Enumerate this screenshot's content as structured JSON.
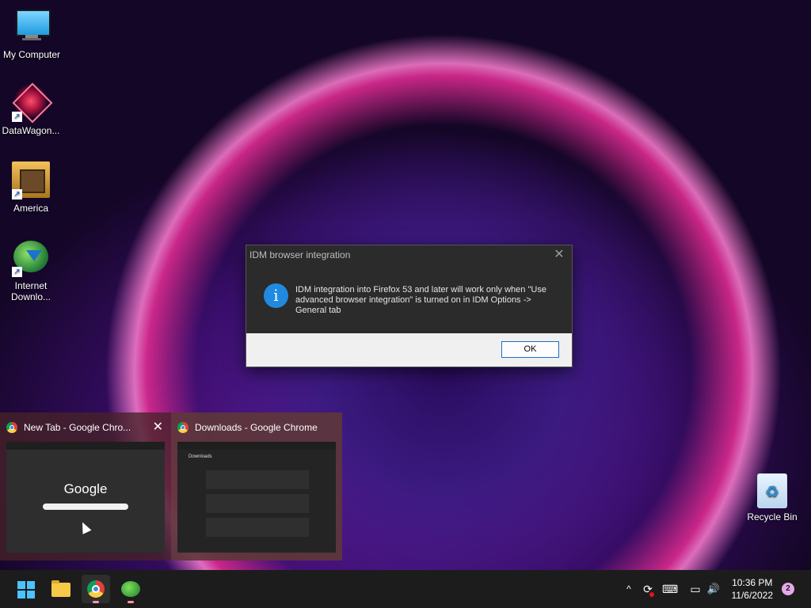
{
  "desktop": {
    "icons": [
      {
        "label": "My Computer",
        "icon": "monitor-icon"
      },
      {
        "label": "DataWagon...",
        "icon": "datawagon-icon"
      },
      {
        "label": "America",
        "icon": "america-game-icon"
      },
      {
        "label": "Internet\nDownlo...",
        "icon": "idm-icon"
      }
    ],
    "recycle_bin": {
      "label": "Recycle Bin",
      "icon": "recycle-bin-icon"
    }
  },
  "dialog": {
    "title": "IDM browser integration",
    "message": "IDM integration into Firefox 53 and later will work only when \"Use advanced browser integration\" is turned on in IDM Options -> General tab",
    "ok_label": "OK",
    "close_glyph": "✕",
    "info_glyph": "i"
  },
  "thumbnails": [
    {
      "title": "New Tab - Google Chro...",
      "preview_text": "Google",
      "close_glyph": "✕"
    },
    {
      "title": "Downloads - Google Chrome",
      "preview_text": "Downloads"
    }
  ],
  "taskbar": {
    "apps": [
      "start-icon",
      "file-explorer-icon",
      "chrome-icon",
      "idm-icon"
    ],
    "tray": {
      "chevron": "^",
      "keyboard_icon": "⌨",
      "network_icon": "▭",
      "volume_icon": "🔊"
    },
    "time": "10:36 PM",
    "date": "11/6/2022",
    "notification_count": "2"
  }
}
